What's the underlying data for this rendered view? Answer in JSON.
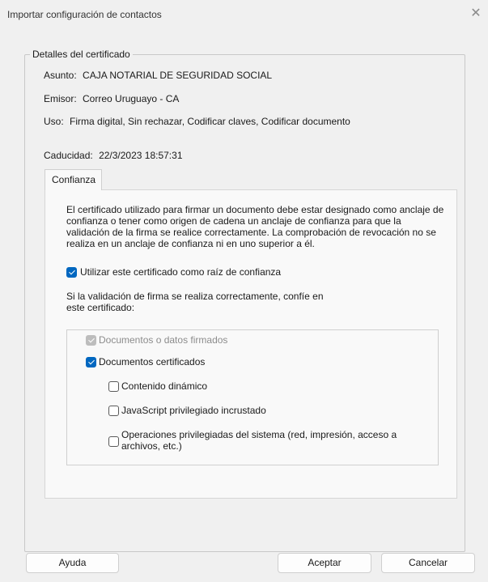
{
  "window": {
    "title": "Importar configuración de contactos",
    "close_glyph": "✕"
  },
  "details": {
    "group_title": "Detalles del certificado",
    "subject_label": "Asunto:",
    "subject_value": "CAJA NOTARIAL DE SEGURIDAD SOCIAL",
    "issuer_label": "Emisor:",
    "issuer_value": "Correo Uruguayo - CA",
    "usage_label": "Uso:",
    "usage_value": "Firma digital, Sin rechazar, Codificar claves, Codificar documento",
    "expiry_label": "Caducidad:",
    "expiry_value": "22/3/2023 18:57:31"
  },
  "tabs": [
    {
      "label": "Confianza",
      "selected": true
    }
  ],
  "trust": {
    "description": "El certificado utilizado para firmar un documento debe estar designado como anclaje de confianza o tener como origen de cadena un anclaje de confianza para que la validación de la firma se realice correctamente. La comprobación de revocación no se realiza en un anclaje de confianza ni en uno superior a él.",
    "root_checkbox": {
      "label": "Utilizar este certificado como raíz de confianza",
      "checked": true
    },
    "trust_prompt": "Si la validación de firma se realiza correctamente, confíe en este certificado:",
    "options": [
      {
        "label": "Documentos o datos firmados",
        "checked": true,
        "disabled": true
      },
      {
        "label": "Documentos certificados",
        "checked": true,
        "disabled": false
      },
      {
        "label": "Contenido dinámico",
        "checked": false,
        "disabled": false
      },
      {
        "label": "JavaScript privilegiado incrustado",
        "checked": false,
        "disabled": false
      },
      {
        "label": "Operaciones privilegiadas del sistema (red, impresión, acceso a archivos, etc.)",
        "checked": false,
        "disabled": false
      }
    ]
  },
  "buttons": {
    "help": "Ayuda",
    "accept": "Aceptar",
    "cancel": "Cancelar"
  },
  "colors": {
    "accent": "#0067c0",
    "background": "#f0f0f0",
    "panel": "#f9f9f9"
  }
}
